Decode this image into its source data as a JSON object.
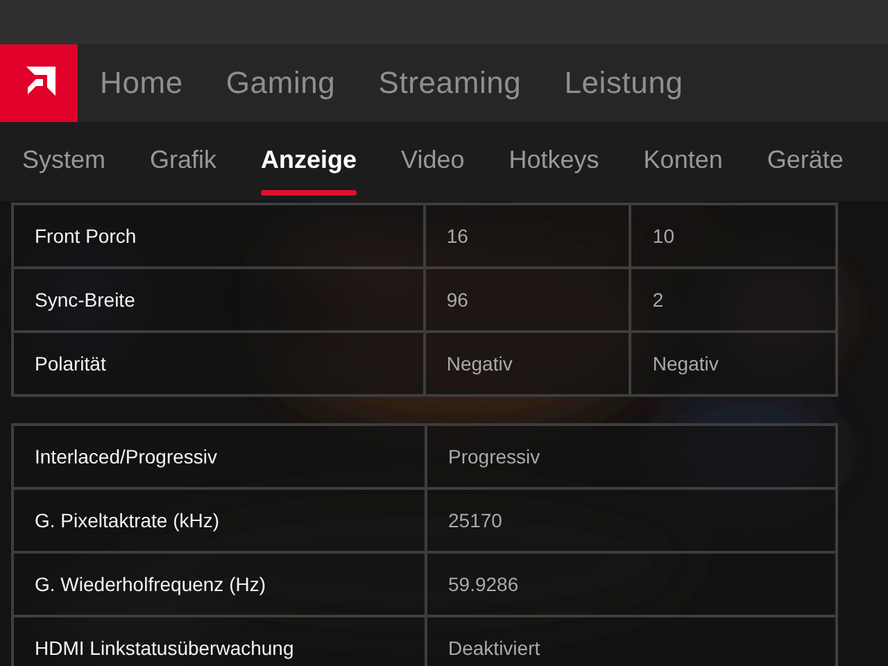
{
  "main_nav": [
    {
      "label": "Home",
      "selected": false
    },
    {
      "label": "Gaming",
      "selected": false
    },
    {
      "label": "Streaming",
      "selected": false
    },
    {
      "label": "Leistung",
      "selected": false
    }
  ],
  "sub_tabs": [
    {
      "label": "System",
      "selected": false
    },
    {
      "label": "Grafik",
      "selected": false
    },
    {
      "label": "Anzeige",
      "selected": true
    },
    {
      "label": "Video",
      "selected": false
    },
    {
      "label": "Hotkeys",
      "selected": false
    },
    {
      "label": "Konten",
      "selected": false
    },
    {
      "label": "Geräte",
      "selected": false
    }
  ],
  "timing_table": {
    "rows": [
      {
        "label": "Front Porch",
        "values": [
          "16",
          "10"
        ]
      },
      {
        "label": "Sync-Breite",
        "values": [
          "96",
          "2"
        ]
      },
      {
        "label": "Polarität",
        "values": [
          "Negativ",
          "Negativ"
        ]
      }
    ]
  },
  "signal_table": {
    "rows": [
      {
        "label": "Interlaced/Progressiv",
        "values": [
          "Progressiv"
        ]
      },
      {
        "label": "G. Pixeltaktrate (kHz)",
        "values": [
          "25170"
        ]
      },
      {
        "label": "G. Wiederholfrequenz (Hz)",
        "values": [
          "59.9286"
        ]
      },
      {
        "label": "HDMI Linkstatusüberwachung",
        "values": [
          "Deaktiviert"
        ]
      }
    ]
  }
}
